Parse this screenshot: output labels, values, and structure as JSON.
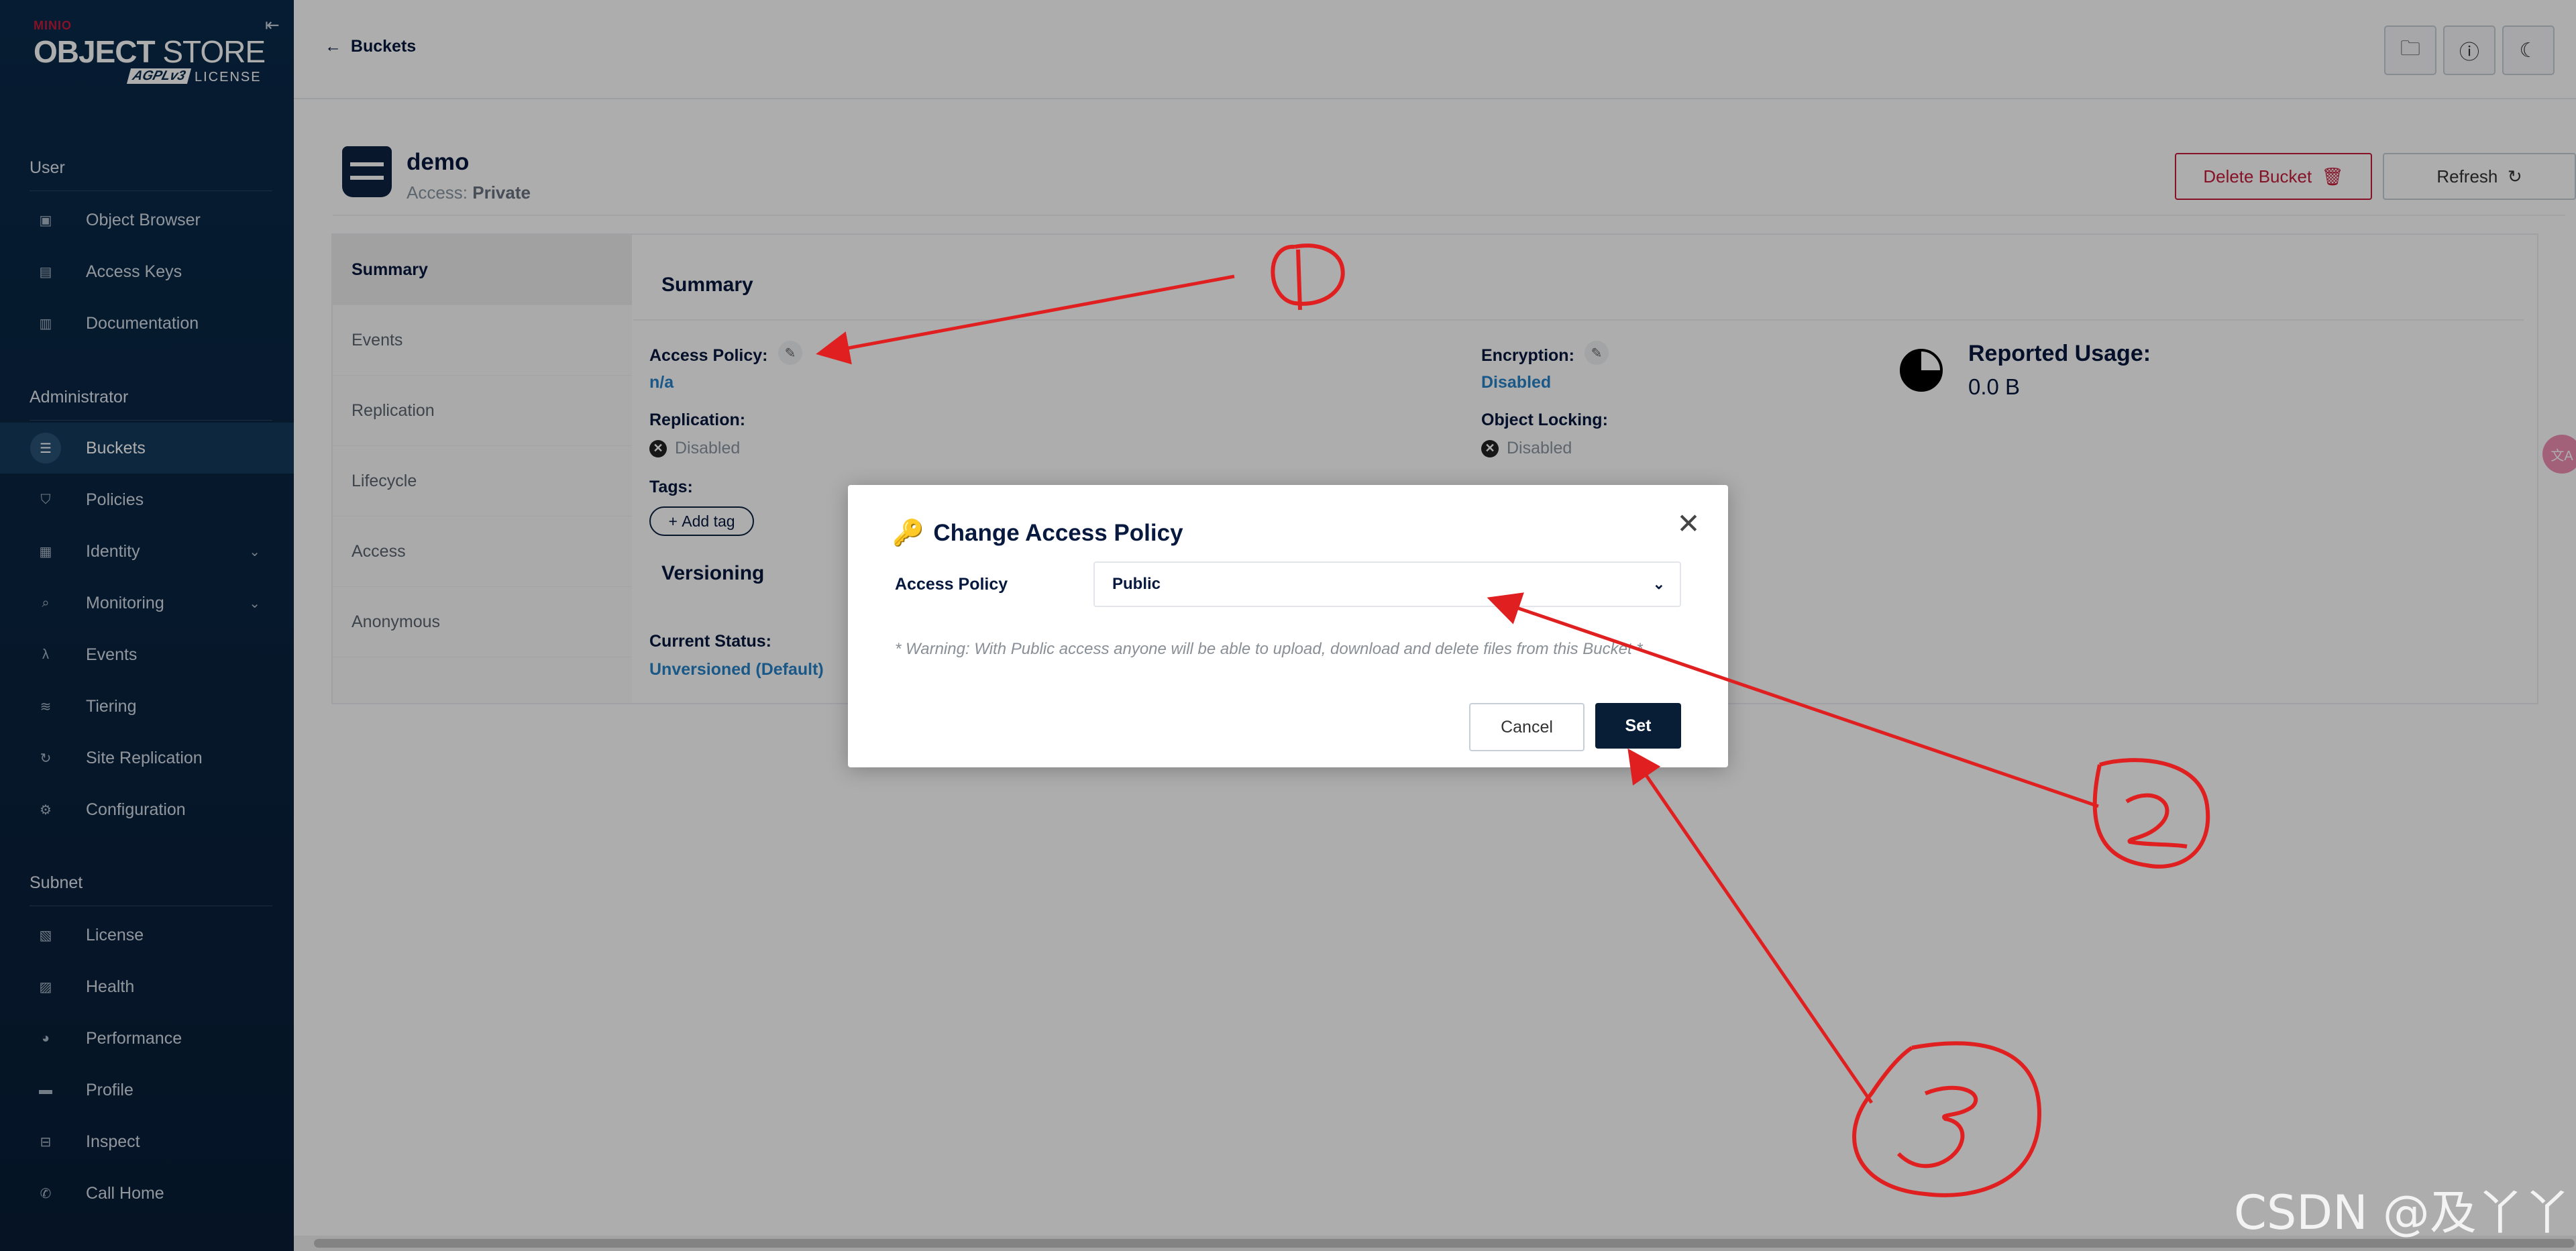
{
  "sidebar": {
    "logo": {
      "brand": "MINIO",
      "title_bold": "OBJECT",
      "title_rest": " STORE",
      "edition": "AGPLv3",
      "license": "LICENSE"
    },
    "sections": [
      {
        "title": "User",
        "items": [
          {
            "label": "Object Browser",
            "icon": "folder-icon"
          },
          {
            "label": "Access Keys",
            "icon": "key-icon"
          },
          {
            "label": "Documentation",
            "icon": "book-icon"
          }
        ]
      },
      {
        "title": "Administrator",
        "items": [
          {
            "label": "Buckets",
            "icon": "bucket-icon",
            "active": true
          },
          {
            "label": "Policies",
            "icon": "shield-icon"
          },
          {
            "label": "Identity",
            "icon": "id-card-icon",
            "expandable": true
          },
          {
            "label": "Monitoring",
            "icon": "magnifier-icon",
            "expandable": true
          },
          {
            "label": "Events",
            "icon": "lambda-icon"
          },
          {
            "label": "Tiering",
            "icon": "tiers-icon"
          },
          {
            "label": "Site Replication",
            "icon": "sync-icon"
          },
          {
            "label": "Configuration",
            "icon": "gear-icon"
          }
        ]
      },
      {
        "title": "Subnet",
        "items": [
          {
            "label": "License",
            "icon": "license-icon"
          },
          {
            "label": "Health",
            "icon": "health-icon"
          },
          {
            "label": "Performance",
            "icon": "gauge-icon"
          },
          {
            "label": "Profile",
            "icon": "profile-icon"
          },
          {
            "label": "Inspect",
            "icon": "inspect-icon"
          },
          {
            "label": "Call Home",
            "icon": "phone-icon"
          }
        ]
      }
    ]
  },
  "header": {
    "back_label": "Buckets"
  },
  "bucket": {
    "name": "demo",
    "access_prefix": "Access: ",
    "access_value": "Private",
    "delete_label": "Delete Bucket",
    "refresh_label": "Refresh"
  },
  "tabs": [
    {
      "label": "Summary",
      "active": true
    },
    {
      "label": "Events"
    },
    {
      "label": "Replication"
    },
    {
      "label": "Lifecycle"
    },
    {
      "label": "Access"
    },
    {
      "label": "Anonymous"
    }
  ],
  "summary": {
    "title": "Summary",
    "access_policy_label": "Access Policy:",
    "access_policy_value": "n/a",
    "replication_label": "Replication:",
    "replication_value": "Disabled",
    "tags_label": "Tags:",
    "add_tag_label": "Add tag",
    "encryption_label": "Encryption:",
    "encryption_value": "Disabled",
    "object_locking_label": "Object Locking:",
    "object_locking_value": "Disabled",
    "usage_label": "Reported Usage:",
    "usage_value": "0.0 B",
    "versioning_title": "Versioning",
    "current_status_label": "Current Status:",
    "current_status_value": "Unversioned (Default)"
  },
  "modal": {
    "title": "Change Access Policy",
    "field_label": "Access Policy",
    "selected_option": "Public",
    "warning": "* Warning: With Public access anyone will be able to upload, download and delete files from this Bucket *",
    "cancel_label": "Cancel",
    "set_label": "Set"
  },
  "annotations": {
    "arrow_color": "#e02020",
    "numbers": [
      "1",
      "2",
      "3"
    ]
  },
  "watermark": "CSDN @及丫丫",
  "colors": {
    "sidebar_bg": "#0a2a4a",
    "primary": "#081d36",
    "link": "#2782c9",
    "danger": "#c51b3a"
  }
}
